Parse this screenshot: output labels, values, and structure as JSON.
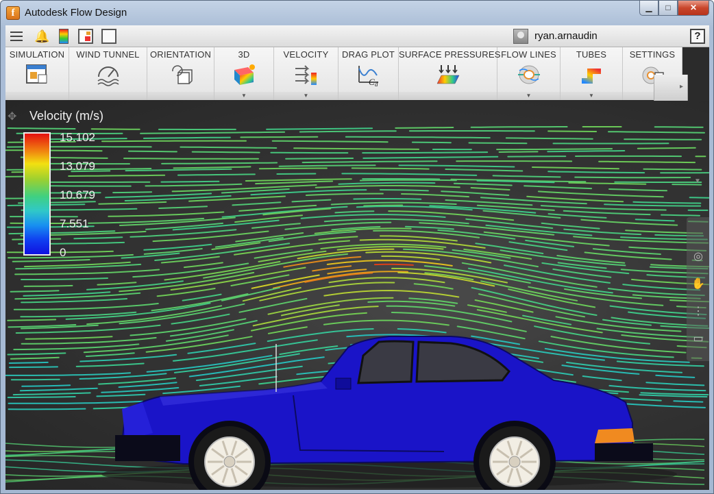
{
  "window": {
    "title": "Autodesk Flow Design",
    "app_icon_letter": "f",
    "controls": {
      "minimize": "▁",
      "maximize": "□",
      "close": "✕"
    }
  },
  "topbar": {
    "user": "ryan.arnaudin",
    "help": "?"
  },
  "ribbon": [
    {
      "label": "SIMULATION",
      "icon": "simulation-icon",
      "has_menu": false
    },
    {
      "label": "WIND TUNNEL",
      "icon": "wind-tunnel-gauge-icon",
      "has_menu": false
    },
    {
      "label": "ORIENTATION",
      "icon": "orientation-cube-icon",
      "has_menu": false
    },
    {
      "label": "3D",
      "icon": "3d-cube-icon",
      "has_menu": true
    },
    {
      "label": "VELOCITY",
      "icon": "velocity-arrows-icon",
      "has_menu": true
    },
    {
      "label": "DRAG PLOT",
      "icon": "drag-plot-icon",
      "has_menu": false
    },
    {
      "label": "SURFACE PRESSURES",
      "icon": "surface-pressure-icon",
      "has_menu": false
    },
    {
      "label": "FLOW LINES",
      "icon": "flow-lines-icon",
      "has_menu": true
    },
    {
      "label": "TUBES",
      "icon": "tubes-icon",
      "has_menu": true
    },
    {
      "label": "SETTINGS",
      "icon": "settings-icon",
      "has_menu": false
    }
  ],
  "legend": {
    "title": "Velocity (m/s)",
    "ticks": [
      "15.102",
      "13.079",
      "10.679",
      "7.551",
      "0"
    ],
    "colors": [
      "#e51010",
      "#f2e010",
      "#40d080",
      "#30c8c8",
      "#1010e0"
    ]
  },
  "drag_plot_glyph": "Cd",
  "accent_colors": {
    "car_body": "#1a14c8",
    "background": "#2b2b2b"
  }
}
